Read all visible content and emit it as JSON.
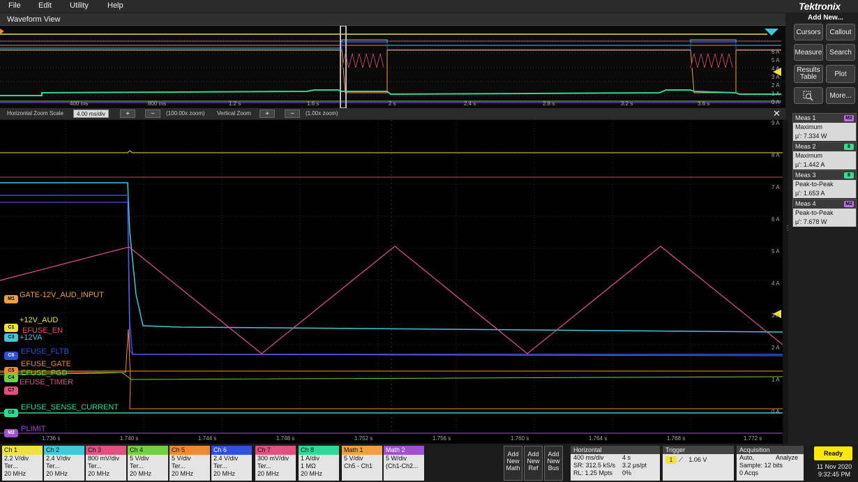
{
  "menu": [
    "File",
    "Edit",
    "Utility",
    "Help"
  ],
  "brand": "Tektronix",
  "add_new": "Add New...",
  "waveform_view_title": "Waveform View",
  "side_buttons": [
    {
      "label": "Cursors"
    },
    {
      "label": "Callout"
    },
    {
      "label": "Measure"
    },
    {
      "label": "Search"
    },
    {
      "label": "Results Table"
    },
    {
      "label": "Plot"
    },
    {
      "label": "search-zoom-icon"
    },
    {
      "label": "More..."
    }
  ],
  "measurements": [
    {
      "title": "Meas 1",
      "badge": "M2",
      "badge_color": "#c070e0",
      "type": "Maximum",
      "value": "µ': 7.334 W"
    },
    {
      "title": "Meas 2",
      "badge": "8",
      "badge_color": "#40d890",
      "type": "Maximum",
      "value": "µ': 1.442 A"
    },
    {
      "title": "Meas 3",
      "badge": "8",
      "badge_color": "#40d890",
      "type": "Peak-to-Peak",
      "value": "µ': 1.653 A"
    },
    {
      "title": "Meas 4",
      "badge": "M2",
      "badge_color": "#c070e0",
      "type": "Peak-to-Peak",
      "value": "µ': 7.678 W"
    }
  ],
  "overview": {
    "x_ticks": [
      "400 ms",
      "800 ms",
      "1.2 s",
      "1.6 s",
      "2 s",
      "2.4 s",
      "2.8 s",
      "3.2 s",
      "3.6 s"
    ],
    "y_ticks": [
      "6 A",
      "5 A",
      "4 A",
      "3 A",
      "2 A",
      "1 A",
      "0 A"
    ]
  },
  "zoom": {
    "h_label": "Horizontal Zoom Scale",
    "h_value": "4.00 ms/div",
    "h_zoom": "(100.00x zoom)",
    "v_label": "Vertical Zoom",
    "v_zoom": "(1.00x zoom)"
  },
  "main": {
    "x_ticks": [
      "1.736 s",
      "1.740 s",
      "1.744 s",
      "1.748 s",
      "1.752 s",
      "1.756 s",
      "1.760 s",
      "1.764 s",
      "1.768 s",
      "1.772 s"
    ],
    "y_ticks": [
      "9 A",
      "8 A",
      "7 A",
      "6 A",
      "5 A",
      "4 A",
      "3 A",
      "2 A",
      "1 A",
      "0 A"
    ],
    "labels": [
      {
        "badge": "M1",
        "text": "GATE-12V_AUD_INPUT",
        "color": "#f0a040"
      },
      {
        "badge": "C1",
        "text": "+12V_AUD",
        "color": "#f0e040"
      },
      {
        "badge": "C7",
        "text": "EFUSE_EN",
        "color": "#e05080"
      },
      {
        "badge": "C3",
        "text": "+12VA",
        "color": "#40c8d8"
      },
      {
        "badge": "C6",
        "text": "EFUSE_FLTB",
        "color": "#3050e0"
      },
      {
        "badge": "C5",
        "text": "EFUSE_GATE",
        "color": "#f08a30"
      },
      {
        "badge": "C4",
        "text": "EFUSE_PGD",
        "color": "#70d040"
      },
      {
        "badge": "C7",
        "text": "EFUSE_TIMER",
        "color": "#e05080"
      },
      {
        "badge": "C8",
        "text": "EFUSE_SENSE_CURRENT",
        "color": "#30d898"
      },
      {
        "badge": "M2",
        "text": "PLIMIT",
        "color": "#a050d0"
      }
    ]
  },
  "channels": [
    {
      "name": "Ch 1",
      "color": "#f0e040",
      "l1": "2.2 V/div",
      "l2": "Ter...",
      "l3": "20 MHz"
    },
    {
      "name": "Ch 2",
      "color": "#40c8d8",
      "l1": "2.4 V/div",
      "l2": "Ter...",
      "l3": "20 MHz"
    },
    {
      "name": "Ch 3",
      "color": "#e05080",
      "l1": "800 mV/div",
      "l2": "Ter...",
      "l3": "20 MHz"
    },
    {
      "name": "Ch 4",
      "color": "#70d040",
      "l1": "5 V/div",
      "l2": "Ter...",
      "l3": "20 MHz"
    },
    {
      "name": "Ch 5",
      "color": "#f08a30",
      "l1": "5 V/div",
      "l2": "Ter...",
      "l3": "20 MHz"
    },
    {
      "name": "Ch 6",
      "color": "#3050e0",
      "l1": "2.4 V/div",
      "l2": "Ter...",
      "l3": "20 MHz"
    },
    {
      "name": "Ch 7",
      "color": "#e05080",
      "l1": "300 mV/div",
      "l2": "Ter...",
      "l3": "20 MHz"
    },
    {
      "name": "Ch 8",
      "color": "#30d898",
      "l1": "1 A/div",
      "l2": "1 MΩ",
      "l3": "20 MHz"
    },
    {
      "name": "Math 1",
      "color": "#f0a040",
      "l1": "5 V/div",
      "l2": "Ch5 - Ch1",
      "l3": ""
    },
    {
      "name": "Math 2",
      "color": "#a050d0",
      "l1": "5 W/div",
      "l2": "(Ch1-Ch2...",
      "l3": ""
    }
  ],
  "add_buttons": [
    {
      "label": "Add New Math"
    },
    {
      "label": "Add New Ref"
    },
    {
      "label": "Add New Bus"
    }
  ],
  "horizontal": {
    "title": "Horizontal",
    "l1a": "400 ms/div",
    "l1b": "4 s",
    "l2a": "SR: 312.5 kS/s",
    "l2b": "3.2 µs/pt",
    "l3a": "RL: 1.25 Mpts",
    "l3b": "0%"
  },
  "trigger": {
    "title": "Trigger",
    "source": "1",
    "level": "1.06 V"
  },
  "acquisition": {
    "title": "Acquisition",
    "l1a": "Auto,",
    "l1b": "Analyze",
    "l2": "Sample: 12 bits",
    "l3": "0 Acqs"
  },
  "status": "Ready",
  "date": "11 Nov 2020",
  "time": "9:32:45 PM"
}
